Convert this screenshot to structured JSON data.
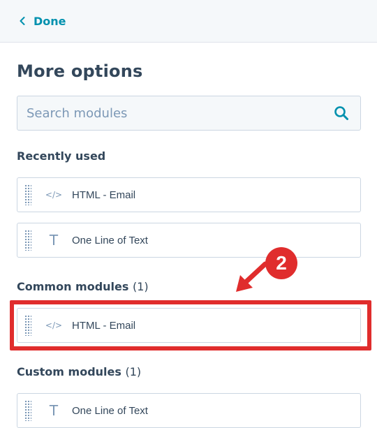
{
  "header": {
    "back_label": "Done"
  },
  "page_title": "More options",
  "search": {
    "placeholder": "Search modules",
    "value": ""
  },
  "sections": {
    "recently_used": {
      "label": "Recently used",
      "items": [
        {
          "icon": "code-icon",
          "icon_glyph": "</>",
          "label": "HTML - Email"
        },
        {
          "icon": "text-icon",
          "icon_glyph": "T",
          "label": "One Line of Text"
        }
      ]
    },
    "common": {
      "label": "Common modules",
      "count": "(1)",
      "items": [
        {
          "icon": "code-icon",
          "icon_glyph": "</>",
          "label": "HTML - Email"
        }
      ]
    },
    "custom": {
      "label": "Custom modules",
      "count": "(1)",
      "items": [
        {
          "icon": "text-icon",
          "icon_glyph": "T",
          "label": "One Line of Text"
        }
      ]
    }
  },
  "annotation": {
    "step_number": "2",
    "color": "#e02d2d"
  },
  "colors": {
    "accent": "#0091ae",
    "text": "#33475b",
    "muted": "#7c98b6"
  }
}
